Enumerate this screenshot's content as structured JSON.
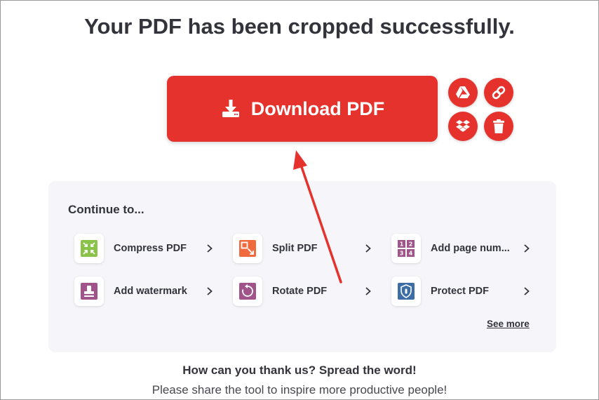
{
  "page": {
    "title": "Your PDF has been cropped successfully.",
    "download_label": "Download PDF",
    "actions": [
      {
        "icon": "google-drive-icon"
      },
      {
        "icon": "link-icon"
      },
      {
        "icon": "dropbox-icon"
      },
      {
        "icon": "trash-icon"
      }
    ]
  },
  "continue": {
    "title": "Continue to...",
    "tools": [
      {
        "label": "Compress PDF",
        "icon": "compress-icon",
        "color": "#8bc34a"
      },
      {
        "label": "Split PDF",
        "icon": "split-icon",
        "color": "#ef6a3d"
      },
      {
        "label": "Add page num...",
        "icon": "page-numbers-icon",
        "color": "#a1548a"
      },
      {
        "label": "Add watermark",
        "icon": "watermark-icon",
        "color": "#a1548a"
      },
      {
        "label": "Rotate PDF",
        "icon": "rotate-icon",
        "color": "#a1548a"
      },
      {
        "label": "Protect PDF",
        "icon": "shield-icon",
        "color": "#3c6ea5"
      }
    ],
    "see_more": "See more"
  },
  "footer": {
    "thanks": "How can you thank us? Spread the word!",
    "share": "Please share the tool to inspire more productive people!"
  },
  "colors": {
    "accent": "#e5322d",
    "annotation_arrow": "#e5322d",
    "panel_bg": "#f5f5fa"
  }
}
